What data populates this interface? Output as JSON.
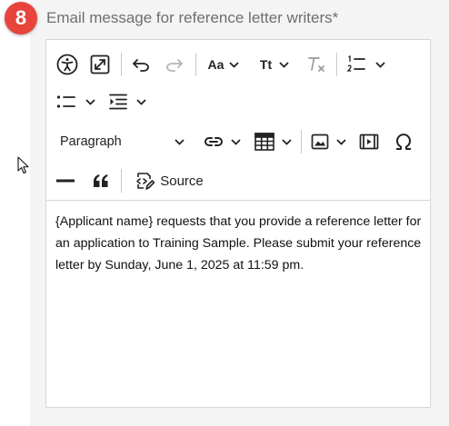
{
  "step_badge": "8",
  "field_label": "Email message for reference letter writers*",
  "toolbar": {
    "accessibility_icon": "accessibility-icon",
    "fullscreen_icon": "fullscreen-icon",
    "undo_icon": "undo-icon",
    "redo_icon": "redo-icon",
    "font_family_label": "Aa",
    "font_size_label": "Tt",
    "clear_format_icon": "clear-formatting-icon",
    "numbered_list_icon": "numbered-list-icon",
    "bulleted_list_icon": "bulleted-list-icon",
    "indent_icon": "indent-icon",
    "paragraph_format": "Paragraph",
    "link_icon": "link-icon",
    "table_icon": "table-icon",
    "image_icon": "image-icon",
    "media_icon": "media-icon",
    "special_chars_icon": "omega-icon",
    "horizontal_line_icon": "horizontal-line-icon",
    "blockquote_icon": "blockquote-icon",
    "source_label": "Source"
  },
  "editor": {
    "content": "{Applicant name} requests that you provide a reference letter for an application to Training Sample. Please submit your reference letter by Sunday, June 1, 2025 at 11:59 pm."
  },
  "colors": {
    "badge": "#e8443c",
    "label": "#6e6e6e",
    "disabled_icon": "#b5b5b5"
  }
}
